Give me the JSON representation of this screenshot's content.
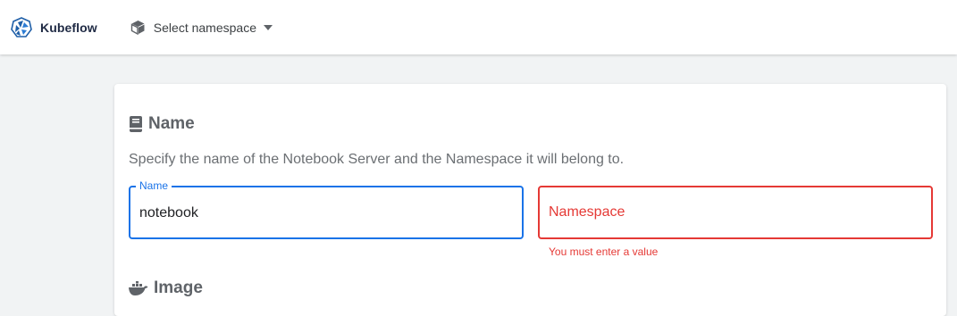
{
  "header": {
    "brand_name": "Kubeflow",
    "namespace_selector_label": "Select namespace",
    "icons": {
      "logo": "kubeflow-logo-icon",
      "namespace": "cube-icon",
      "dropdown": "caret-down-icon"
    }
  },
  "form": {
    "name_section": {
      "title": "Name",
      "icon": "book-icon",
      "description": "Specify the name of the Notebook Server and the Namespace it will belong to.",
      "name_field": {
        "label": "Name",
        "value": "notebook"
      },
      "namespace_field": {
        "placeholder": "Namespace",
        "error": "You must enter a value"
      }
    },
    "image_section": {
      "title": "Image",
      "icon": "docker-icon"
    }
  },
  "colors": {
    "accent": "#1a73e8",
    "error": "#e53935",
    "brand": "#1f2a44",
    "background": "#f1f3f4"
  }
}
